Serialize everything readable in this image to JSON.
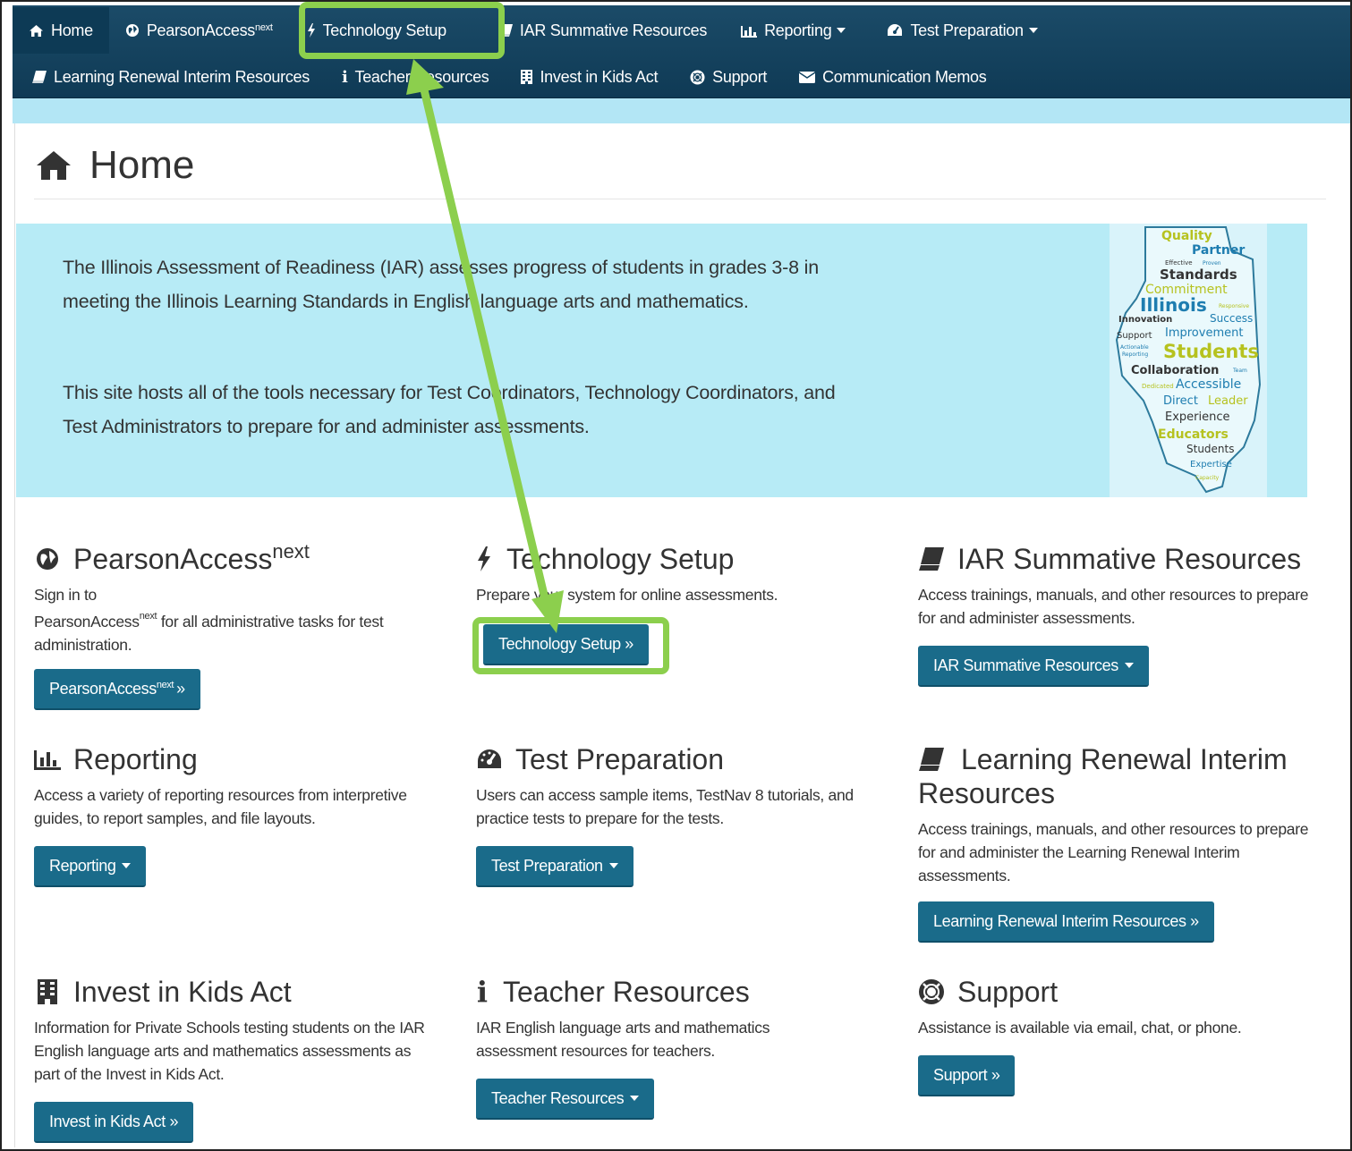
{
  "nav": {
    "row1": [
      {
        "label": "Home",
        "icon": "home-icon"
      },
      {
        "label": "PearsonAccess",
        "sup": "next",
        "icon": "globe-icon"
      },
      {
        "label": "Technology Setup",
        "icon": "bolt-icon"
      },
      {
        "label": "IAR Summative Resources",
        "icon": "book-icon"
      },
      {
        "label": "Reporting",
        "icon": "bar-chart-icon"
      },
      {
        "label": "Test Preparation",
        "icon": "dashboard-icon"
      }
    ],
    "row2": [
      {
        "label": "Learning Renewal Interim Resources",
        "icon": "book-icon"
      },
      {
        "label": "Teacher Resources",
        "icon": "info-icon"
      },
      {
        "label": "Invest in Kids Act",
        "icon": "building-icon"
      },
      {
        "label": "Support",
        "icon": "life-ring-icon"
      },
      {
        "label": "Communication Memos",
        "icon": "envelope-icon"
      }
    ]
  },
  "page_title": "Home",
  "jumbotron": {
    "p1": "The Illinois Assessment of Readiness (IAR) assesses progress of students in grades 3-8 in meeting the Illinois Learning Standards in English language arts and mathematics.",
    "p2": "This site hosts all of the tools necessary for Test Coordinators, Technology Coordinators, and Test Administrators to prepare for and administer assessments.",
    "wordmap_words": [
      "Quality",
      "Partner",
      "Effective",
      "Proven",
      "Standards",
      "Commitment",
      "Illinois",
      "Responsive",
      "Innovation",
      "Success",
      "Support",
      "Improvement",
      "Actionable",
      "Reporting",
      "Students",
      "Collaboration",
      "Team",
      "Dedicated",
      "Accessible",
      "Direct",
      "Leader",
      "Experience",
      "Educators",
      "Students",
      "Expertise",
      "Capacity"
    ]
  },
  "cards": {
    "pearson": {
      "title": "PearsonAccess",
      "title_sup": "next",
      "desc_a": "Sign in to",
      "desc_b": "PearsonAccess",
      "desc_sup": "next",
      "desc_c": " for all administrative tasks for test administration.",
      "btn": "PearsonAccess",
      "btn_sup": "next",
      "btn_tail": "»"
    },
    "tech": {
      "title": "Technology Setup",
      "desc": "Prepare your system for online assessments.",
      "btn": "Technology Setup »"
    },
    "iar": {
      "title": "IAR Summative Resources",
      "desc": "Access trainings, manuals, and other resources to prepare for and administer assessments.",
      "btn": "IAR Summative Resources"
    },
    "reporting": {
      "title": "Reporting",
      "desc": "Access a variety of reporting resources from interpretive guides, to report samples, and file layouts.",
      "btn": "Reporting"
    },
    "testprep": {
      "title": "Test Preparation",
      "desc": "Users can access sample items, TestNav 8 tutorials, and practice tests to prepare for the tests.",
      "btn": "Test Preparation"
    },
    "learning": {
      "title": "Learning Renewal Interim Resources",
      "desc": "Access trainings, manuals, and other resources to prepare for and administer the Learning Renewal Interim assessments.",
      "btn": "Learning Renewal Interim Resources »"
    },
    "invest": {
      "title": "Invest in Kids Act",
      "desc": "Information for Private Schools testing students on the IAR English language arts and mathematics assessments as part of the Invest in Kids Act.",
      "btn": "Invest in Kids Act »"
    },
    "teacher": {
      "title": "Teacher Resources",
      "desc": "IAR English language arts and mathematics assessment resources for teachers.",
      "btn": "Teacher Resources"
    },
    "support": {
      "title": "Support",
      "desc": "Assistance is available via email, chat, or phone.",
      "btn": "Support »"
    }
  },
  "colors": {
    "navbar": "#124462",
    "button": "#1a6b8a",
    "jumbotron": "#b7ebf6",
    "highlight": "#8ccf4d"
  }
}
